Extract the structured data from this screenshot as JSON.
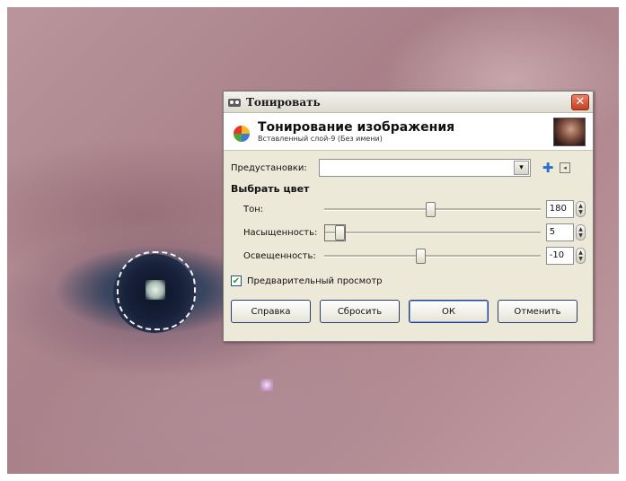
{
  "dialog": {
    "title": "Тонировать",
    "header_title": "Тонирование изображения",
    "header_subtitle": "Вставленный слой-9 (Без имени)",
    "presets_label": "Предустановки:",
    "presets_value": "",
    "section_title": "Выбрать цвет",
    "sliders": [
      {
        "label": "Тон:",
        "value": "180",
        "fraction": 0.5
      },
      {
        "label": "Насыщенность:",
        "value": "5",
        "fraction": 0.05
      },
      {
        "label": "Освещенность:",
        "value": "-10",
        "fraction": 0.45
      }
    ],
    "preview_label": "Предварительный просмотр",
    "preview_checked": true,
    "buttons": {
      "help": "Справка",
      "reset": "Сбросить",
      "ok": "ОК",
      "cancel": "Отменить"
    }
  },
  "icons": {
    "close": "close-icon",
    "plus": "plus-icon",
    "menu": "menu-icon",
    "dropdown": "chevron-down-icon"
  },
  "colors": {
    "dialog_bg": "#ece9d8",
    "close_button": "#c1401f",
    "selection": "#f4f4f4"
  }
}
